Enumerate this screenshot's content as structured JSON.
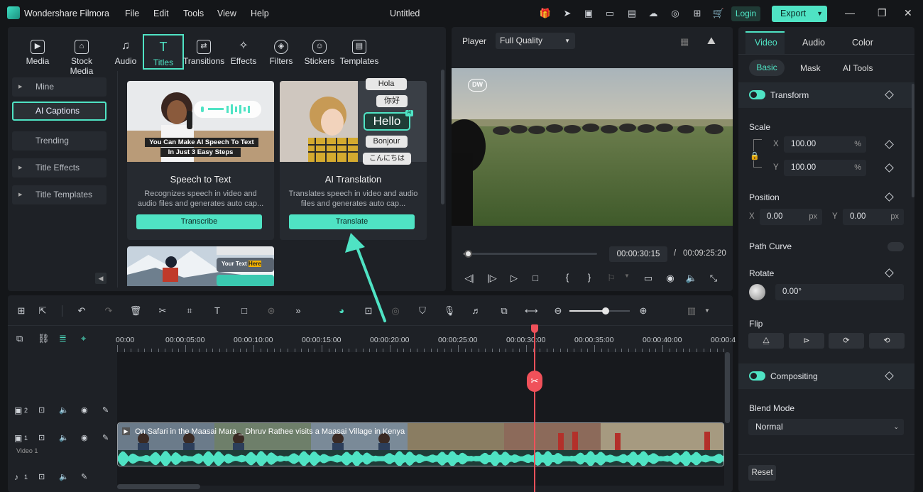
{
  "app": {
    "name": "Wondershare Filmora",
    "doc_title": "Untitled",
    "login": "Login",
    "export": "Export"
  },
  "menu": [
    "File",
    "Edit",
    "Tools",
    "View",
    "Help"
  ],
  "tabs": [
    {
      "label": "Media",
      "icon": "media-icon"
    },
    {
      "label": "Stock Media",
      "icon": "stock-media-icon"
    },
    {
      "label": "Audio",
      "icon": "audio-icon"
    },
    {
      "label": "Titles",
      "icon": "titles-icon"
    },
    {
      "label": "Transitions",
      "icon": "transitions-icon"
    },
    {
      "label": "Effects",
      "icon": "effects-icon"
    },
    {
      "label": "Filters",
      "icon": "filters-icon"
    },
    {
      "label": "Stickers",
      "icon": "stickers-icon"
    },
    {
      "label": "Templates",
      "icon": "templates-icon"
    }
  ],
  "sidebar": [
    "Mine",
    "AI Captions",
    "Trending",
    "Title Effects",
    "Title Templates"
  ],
  "cards": [
    {
      "title": "Speech to Text",
      "desc1": "Recognizes speech in video and",
      "desc2": "audio files and generates auto cap...",
      "button": "Transcribe",
      "overlay1": "You Can Make AI Speech To Text",
      "overlay2": "In Just  3 Easy Steps"
    },
    {
      "title": "AI Translation",
      "desc1": "Translates speech in video and audio",
      "desc2": "files and generates auto cap...",
      "button": "Translate",
      "words": [
        "Hola",
        "你好",
        "Hello",
        "Bonjour",
        "こんにちは"
      ],
      "ai_badge": "AI"
    }
  ],
  "card3": {
    "text1": "Your Text",
    "text2": "Here"
  },
  "player": {
    "label": "Player",
    "quality": "Full Quality",
    "current_time": "00:00:30:15",
    "separator": "/",
    "total_time": "00:09:25:20",
    "watermark": "DW",
    "progress": 0.03
  },
  "props": {
    "tabs": [
      "Video",
      "Audio",
      "Color"
    ],
    "subtabs": [
      "Basic",
      "Mask",
      "AI Tools"
    ],
    "transform": "Transform",
    "scale": "Scale",
    "x_label": "X",
    "y_label": "Y",
    "scale_x": "100.00",
    "scale_y": "100.00",
    "percent": "%",
    "position": "Position",
    "pos_x": "0.00",
    "pos_y": "0.00",
    "px": "px",
    "path_curve": "Path Curve",
    "rotate": "Rotate",
    "rotate_val": "0.00°",
    "flip": "Flip",
    "compositing": "Compositing",
    "blend_mode": "Blend Mode",
    "blend_val": "Normal",
    "reset": "Reset"
  },
  "timeline": {
    "ruler": [
      "00:00",
      "00:00:05:00",
      "00:00:10:00",
      "00:00:15:00",
      "00:00:20:00",
      "00:00:25:00",
      "00:00:30:00",
      "00:00:35:00",
      "00:00:40:00",
      "00:00:4"
    ],
    "track2": "2",
    "track1": "1",
    "track1_name": "Video 1",
    "audio1": "1",
    "clip_title": "On Safari in the Maasai Mara _ Dhruv Rathee visits a Maasai Village in Kenya",
    "zoom": 0.6
  }
}
